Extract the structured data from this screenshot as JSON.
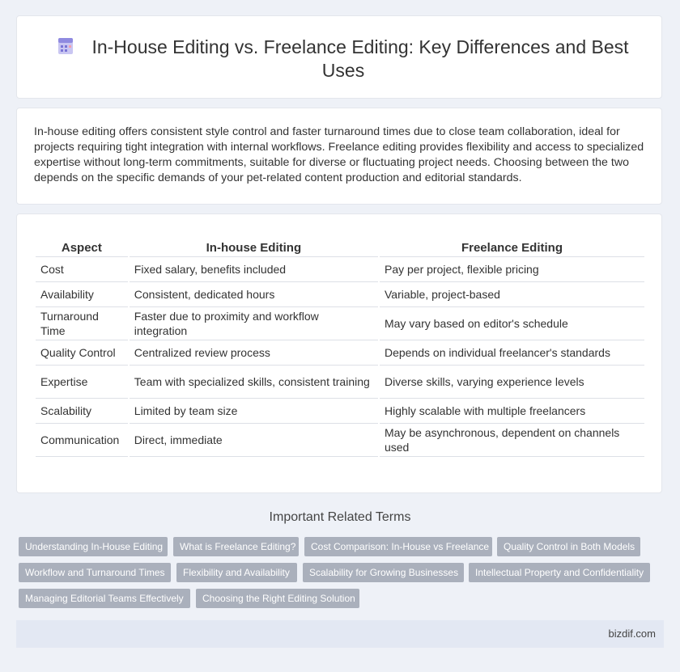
{
  "header": {
    "title": "In-House Editing vs. Freelance Editing: Key Differences and Best Uses",
    "icon": "document-icon"
  },
  "intro": {
    "text": "In-house editing offers consistent style control and faster turnaround times due to close team collaboration, ideal for projects requiring tight integration with internal workflows. Freelance editing provides flexibility and access to specialized expertise without long-term commitments, suitable for diverse or fluctuating project needs. Choosing between the two depends on the specific demands of your pet-related content production and editorial standards."
  },
  "table": {
    "headers": [
      "Aspect",
      "In-house Editing",
      "Freelance Editing"
    ],
    "rows": [
      [
        "Cost",
        "Fixed salary, benefits included",
        "Pay per project, flexible pricing"
      ],
      [
        "Availability",
        "Consistent, dedicated hours",
        "Variable, project-based"
      ],
      [
        "Turnaround Time",
        "Faster due to proximity and workflow integration",
        "May vary based on editor's schedule"
      ],
      [
        "Quality Control",
        "Centralized review process",
        "Depends on individual freelancer's standards"
      ],
      [
        "Expertise",
        "Team with specialized skills, consistent training",
        "Diverse skills, varying experience levels"
      ],
      [
        "Scalability",
        "Limited by team size",
        "Highly scalable with multiple freelancers"
      ],
      [
        "Communication",
        "Direct, immediate",
        "May be asynchronous, dependent on channels used"
      ]
    ]
  },
  "related": {
    "heading": "Important Related Terms",
    "tags": [
      "Understanding In-House Editing",
      "What is Freelance Editing?",
      "Cost Comparison: In-House vs Freelance",
      "Quality Control in Both Models",
      "Workflow and Turnaround Times",
      "Flexibility and Availability",
      "Scalability for Growing Businesses",
      "Intellectual Property and Confidentiality",
      "Managing Editorial Teams Effectively",
      "Choosing the Right Editing Solution"
    ]
  },
  "footer": {
    "site": "bizdif.com"
  },
  "colors": {
    "background": "#eef1f7",
    "tag": "#aab0bc",
    "footer": "#e3e8f3"
  }
}
